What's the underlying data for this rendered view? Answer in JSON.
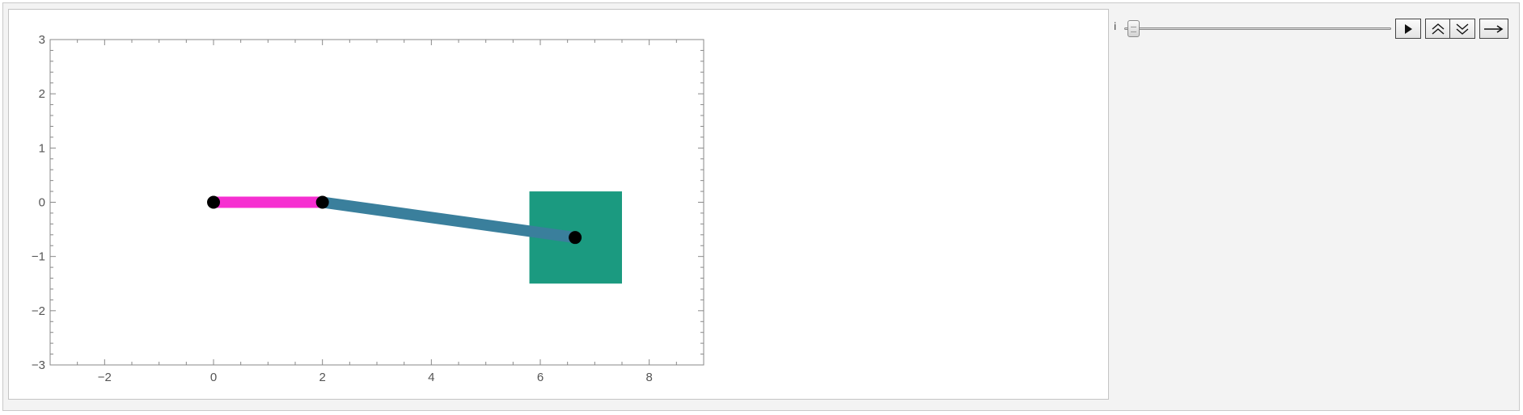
{
  "control": {
    "variable_label": "i",
    "slider_position": 0.0
  },
  "buttons": {
    "play": "play-icon",
    "faster": "double-chevron-up-icon",
    "slower": "double-chevron-down-icon",
    "direction": "arrow-right-icon"
  },
  "chart_data": {
    "type": "scatter",
    "xlim": [
      -3,
      9
    ],
    "ylim": [
      -3,
      3
    ],
    "x_ticks": [
      -2,
      0,
      2,
      4,
      6,
      8
    ],
    "y_ticks": [
      -3,
      -2,
      -1,
      0,
      1,
      2,
      3
    ],
    "x_tick_labels": [
      "−2",
      "0",
      "2",
      "4",
      "6",
      "8"
    ],
    "y_tick_labels": [
      "−3",
      "−2",
      "−1",
      "0",
      "1",
      "2",
      "3"
    ],
    "links": [
      {
        "from": [
          0,
          0
        ],
        "to": [
          2,
          0
        ],
        "color": "#f62fd1"
      },
      {
        "from": [
          2,
          0
        ],
        "to": [
          6.64,
          -0.65
        ],
        "color": "#3a7f9c"
      }
    ],
    "joints": [
      [
        0,
        0
      ],
      [
        2,
        0
      ],
      [
        6.64,
        -0.65
      ]
    ],
    "square": {
      "x": [
        5.8,
        7.5
      ],
      "y": [
        -1.5,
        0.2
      ],
      "color": "#1b9a80"
    },
    "frame": true,
    "grid": false
  }
}
